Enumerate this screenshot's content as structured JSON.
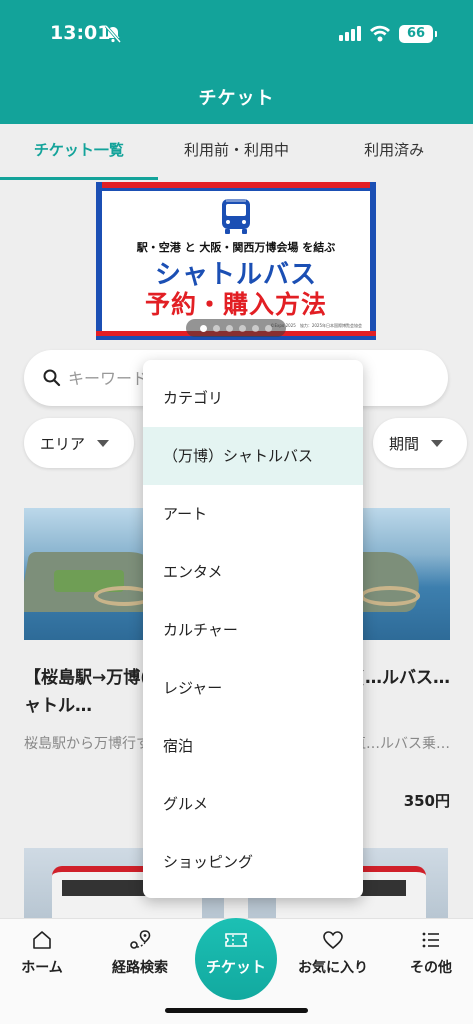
{
  "status_bar": {
    "time": "13:01",
    "battery": "66"
  },
  "header": {
    "title": "チケット"
  },
  "tabs": [
    {
      "label": "チケット一覧",
      "active": true
    },
    {
      "label": "利用前・利用中",
      "active": false
    },
    {
      "label": "利用済み",
      "active": false
    }
  ],
  "banner": {
    "subtitle": "駅・空港 と 大阪・関西万博会場 を結ぶ",
    "main": "シャトルバス",
    "red": "予約・購入方法",
    "footnote": "©Expo 2025　協力：2025年日本国際博覧会協会",
    "page_indicator": {
      "total": 6,
      "current": 1
    }
  },
  "search": {
    "placeholder": "キーワード"
  },
  "filters": {
    "area": "エリア",
    "period": "期間"
  },
  "cards": [
    {
      "title": "【桜島駅→万博(万博)駅シャトル…",
      "desc": "桜島駅から万博行する駅シャト…",
      "price": ""
    },
    {
      "title": "…桜島駅】(…ルバス…",
      "desc": "…島駅まで直…ルバス乗…",
      "price": "350円"
    }
  ],
  "dropdown": {
    "items": [
      {
        "label": "カテゴリ",
        "selected": false
      },
      {
        "label": "（万博）シャトルバス",
        "selected": true
      },
      {
        "label": "アート",
        "selected": false
      },
      {
        "label": "エンタメ",
        "selected": false
      },
      {
        "label": "カルチャー",
        "selected": false
      },
      {
        "label": "レジャー",
        "selected": false
      },
      {
        "label": "宿泊",
        "selected": false
      },
      {
        "label": "グルメ",
        "selected": false
      },
      {
        "label": "ショッピング",
        "selected": false
      }
    ]
  },
  "bottom_nav": {
    "home": "ホーム",
    "route": "経路検索",
    "ticket": "チケット",
    "favorites": "お気に入り",
    "other": "その他"
  },
  "colors": {
    "brand": "#13a39a",
    "banner_blue": "#1b4fb4",
    "banner_red": "#e21f24"
  }
}
